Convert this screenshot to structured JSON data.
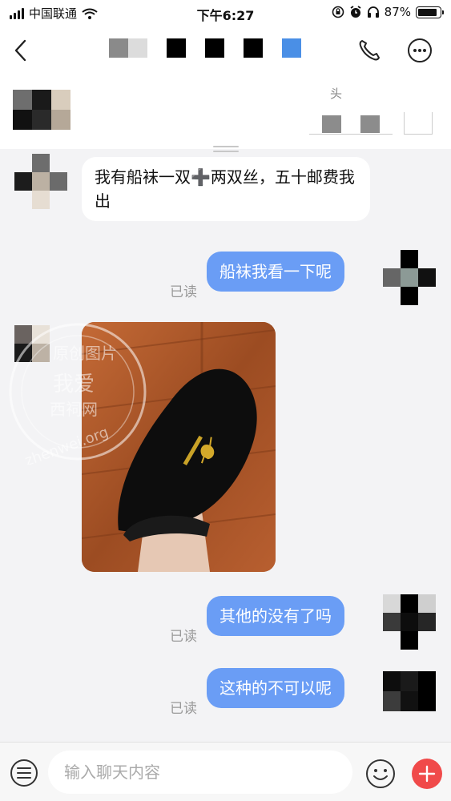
{
  "status_bar": {
    "carrier": "中国联通",
    "time": "下午6:27",
    "battery": "87%",
    "battery_level": 0.87
  },
  "profile": {
    "tag": "头"
  },
  "messages": [
    {
      "side": "in",
      "text": "我有船袜一双➕两双丝，五十邮费我出"
    },
    {
      "side": "out",
      "text": "船袜我看一下呢",
      "status": "已读"
    },
    {
      "side": "in",
      "type": "image"
    },
    {
      "side": "out",
      "text": "其他的没有了吗",
      "status": "已读"
    },
    {
      "side": "out",
      "text": "这种的不可以呢",
      "status": "已读"
    }
  ],
  "watermark": {
    "line1": "原创图片",
    "line2": "我爱",
    "line3": "西祠网",
    "line4": "zhenwei.org"
  },
  "input": {
    "placeholder": "输入聊天内容"
  },
  "colors": {
    "outgoing_bubble": "#6a9df5",
    "plus_button": "#f04a4a",
    "title_accent": "#4a8fe6"
  }
}
